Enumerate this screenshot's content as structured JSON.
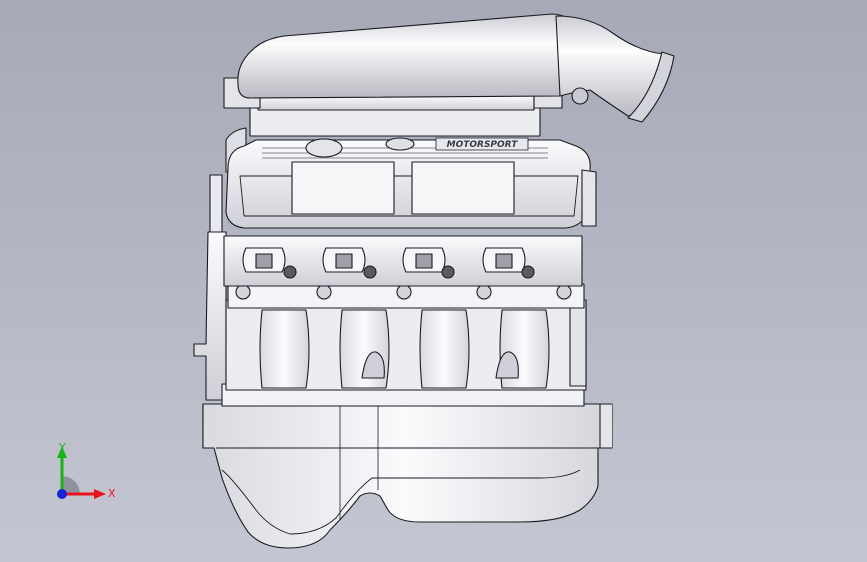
{
  "colors": {
    "background": "#a9acb9",
    "background_light": "#c3c6d1",
    "metal_light": "#f4f5f8",
    "metal_mid": "#dcdde3",
    "metal_dark": "#a7a8b0",
    "outline": "#1b1b22",
    "axis_x": "#e8141c",
    "axis_y": "#18b418",
    "axis_z": "#1522d6"
  },
  "triad": {
    "x_label": "X",
    "y_label": "Y"
  },
  "model": {
    "valve_cover_emblem": "MOTORSPORT",
    "cylinder_count": 4
  }
}
